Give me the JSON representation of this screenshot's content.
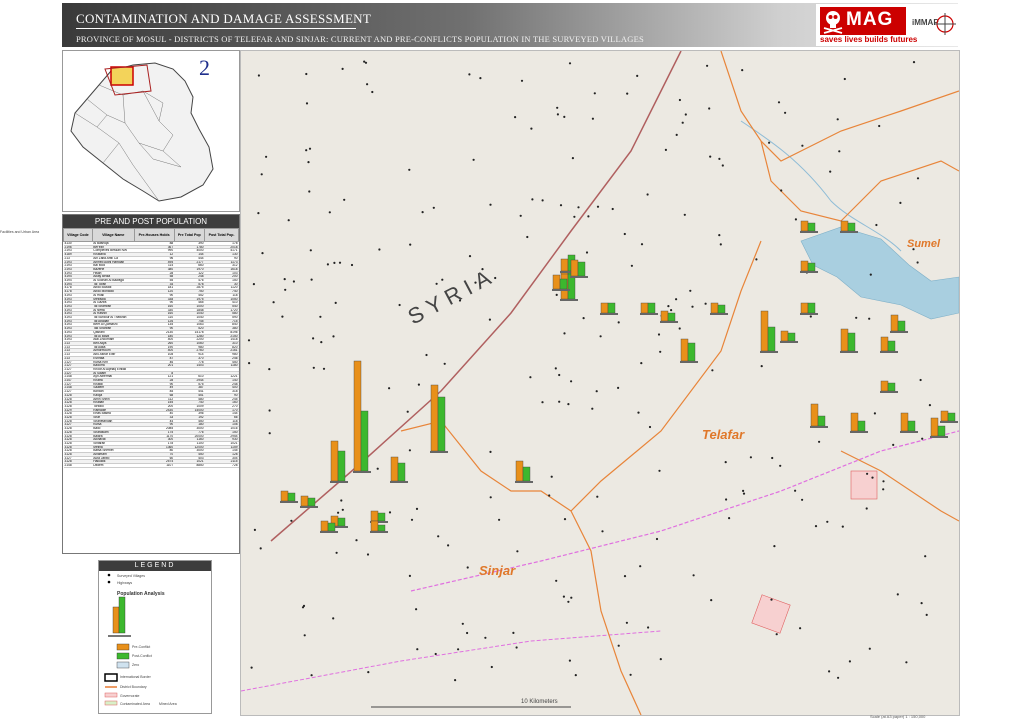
{
  "header": {
    "title": "CONTAMINATION AND DAMAGE ASSESSMENT",
    "subtitle": "PROVINCE OF MOSUL - DISTRICTS OF TELEFAR AND SINJAR:    CURRENT AND PRE-CONFLICTS POPULATION IN THE SURVEYED VILLAGES"
  },
  "logos": {
    "mag": "MAG",
    "tagline": "saves lives builds futures",
    "immap": "iMMAP"
  },
  "inset": {
    "number": "2"
  },
  "population_panel": {
    "title": "PRE AND POST POPULATION",
    "headers": [
      "Village Code",
      "Village Name",
      "Pre-Houses Holds",
      "Pre Total Pop",
      "Post Total Pop."
    ],
    "rows": [
      [
        "4130",
        "Al Bashiqa",
        "88",
        "390",
        "178"
      ],
      [
        "2196",
        "Ber'ezh",
        "367",
        "1780",
        "2018"
      ],
      [
        "2193",
        "Complexes Bessan NW",
        "990",
        "4000",
        "4171"
      ],
      [
        "4189",
        "Khailana",
        "12",
        "144",
        "130"
      ],
      [
        "213",
        "Ain Zalta Arbil Ca",
        "96",
        "444",
        "90"
      ],
      [
        "2193",
        "Ahmed Alghi Hamdan",
        "495",
        "2177",
        "1173"
      ],
      [
        "2193",
        "Bal Mod",
        "114",
        "660",
        "312"
      ],
      [
        "2193",
        "Bazerte",
        "380",
        "1970",
        "1618"
      ],
      [
        "4193",
        "Hisan",
        "28",
        "122",
        "103"
      ],
      [
        "4194",
        "Alkay Bedia",
        "58",
        "248",
        "200"
      ],
      [
        "4194",
        "Al Sochan Al Bawaga",
        "55",
        "476",
        "150"
      ],
      [
        "4194",
        "Tal Torah",
        "34",
        "578",
        "30"
      ],
      [
        "4178",
        "Abdo Bozadi",
        "181",
        "2875",
        "1120"
      ],
      [
        "4178",
        "Abdo Monwad",
        "120",
        "750",
        "740"
      ],
      [
        "4193",
        "Al Hilali",
        "90",
        "452",
        "118"
      ],
      [
        "4193",
        "Metradia",
        "338",
        "1975",
        "1050"
      ],
      [
        "4193",
        "Al Gazira",
        "90",
        "465",
        "410"
      ],
      [
        "4193",
        "Tal Shamrah",
        "160",
        "1000",
        "540"
      ],
      [
        "4193",
        "Al Nefta",
        "330",
        "1848",
        "1720"
      ],
      [
        "4193",
        "Al Rashin",
        "160",
        "1040",
        "580"
      ],
      [
        "4193",
        "Tal Surdour Al Thawrah",
        "110",
        "1040",
        "590"
      ],
      [
        "4193",
        "Tal Abadah",
        "126",
        "745",
        "715"
      ],
      [
        "4193",
        "Beer Al Qamarzo",
        "135",
        "1063",
        "840"
      ],
      [
        "4193",
        "Tak Shahrah",
        "90",
        "520",
        "380"
      ],
      [
        "4193",
        "Qasrani",
        "2130",
        "14178",
        "8196"
      ],
      [
        "4193",
        "Tal Al Baya",
        "180",
        "1280",
        "2150"
      ],
      [
        "4193",
        "Atal Zhoorham",
        "400",
        "2200",
        "1418"
      ],
      [
        "213",
        "Beit Aliya",
        "260",
        "1060",
        "310"
      ],
      [
        "213",
        "Tal Alata",
        "190",
        "980",
        "820"
      ],
      [
        "213",
        "Almormoum",
        "400",
        "2760",
        "2161"
      ],
      [
        "213",
        "Abu Ashar Elbir",
        "108",
        "914",
        "980"
      ],
      [
        "213",
        "Eshrata",
        "87",
        "370",
        "246"
      ],
      [
        "2127",
        "Kutsa Kirn",
        "46",
        "778",
        "450"
      ],
      [
        "2127",
        "Badorra",
        "201",
        "1403",
        "1180"
      ],
      [
        "2127",
        "Khodr Al Aqelaq Elhilali",
        "",
        "",
        ""
      ],
      [
        "2127",
        "Al Salam",
        "8",
        "",
        ""
      ],
      [
        "2148",
        "Ayn Alhermal",
        "121",
        "610",
        "1221"
      ],
      [
        "2147",
        "Khatra",
        "28",
        "2944",
        "140"
      ],
      [
        "2127",
        "Khalidi",
        "90",
        "575",
        "248"
      ],
      [
        "2148",
        "Saalem",
        "49",
        "387",
        "400"
      ],
      [
        "2127",
        "Bordan",
        "84",
        "441",
        "318"
      ],
      [
        "3128",
        "Kaloja",
        "68",
        "451",
        "90"
      ],
      [
        "3128",
        "Amin Shirin",
        "112",
        "480",
        "245"
      ],
      [
        "3128",
        "Khatlan",
        "155",
        "740",
        "160"
      ],
      [
        "3128",
        "Tortoko",
        "200",
        "1009",
        "270"
      ],
      [
        "3129",
        "Ramadie",
        "2430",
        "14000",
        "170"
      ],
      [
        "3128",
        "Ertas Bastra",
        "40",
        "396",
        "144"
      ],
      [
        "3128",
        "Shaf",
        "33",
        "192",
        "66"
      ],
      [
        "3128",
        "Shanetandan",
        "44",
        "450",
        "118"
      ],
      [
        "3127",
        "Kutsa",
        "90",
        "180",
        "108"
      ],
      [
        "3128",
        "Ballo",
        "2085",
        "3000",
        "1016"
      ],
      [
        "3128",
        "Sharaslam",
        "175",
        "776",
        "150"
      ],
      [
        "3128",
        "Bajara",
        "1170",
        "20000",
        "2954"
      ],
      [
        "3128",
        "Alkhavat",
        "300",
        "1160",
        "930"
      ],
      [
        "3128",
        "Sintarah",
        "178",
        "1100",
        "1021"
      ],
      [
        "3128",
        "Meliha",
        "1360",
        "12000",
        "1159"
      ],
      [
        "3128",
        "Batsa Sherbet",
        "80",
        "3000",
        "145"
      ],
      [
        "3128",
        "Alhamam",
        "70",
        "450",
        "128"
      ],
      [
        "3127",
        "Auta Jabbo",
        "60",
        "403",
        "304"
      ],
      [
        "3128",
        "Hakuldik",
        "2574",
        "1021",
        "2115"
      ],
      [
        "2148",
        "Ditdem",
        "1107",
        "8850",
        "728"
      ]
    ]
  },
  "map": {
    "country_label": "SYRIA",
    "towns": [
      "Sumel",
      "Telafar",
      "Sinjar"
    ],
    "scale": "10 Kilometers",
    "chart_series": [
      {
        "name": "Pre-conflict population",
        "color": "#e8901a"
      },
      {
        "name": "Current population",
        "color": "#3cb82e"
      }
    ]
  },
  "legend": {
    "title": "LEGEND",
    "item_village": "Surveyed Villages",
    "item_highways": "Highways",
    "subtitle": "Population Analysis",
    "item_pre": "Pre-Conflict",
    "item_post": "Post-Conflict",
    "item_zero": "Zero",
    "item_border": "International Border",
    "item_district": "District Boundary",
    "item_gov": "Governorate",
    "item_contaminated": "Contaminated Area",
    "item_mined": "Mined Area"
  },
  "side_note": "Facilities and\nUrban Area",
  "footer": "Scale (at A3 paper) 1 : 150,000"
}
